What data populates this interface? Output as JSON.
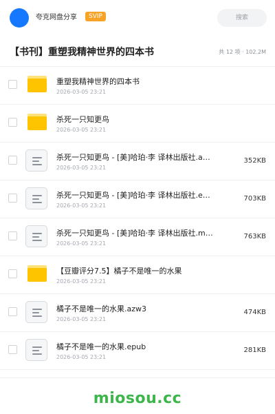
{
  "header": {
    "app_name": "夸克网盘分享",
    "badge": "SVIP",
    "search_placeholder": "搜索"
  },
  "folder": {
    "title": "【书刊】重塑我精神世界的四本书",
    "summary": "共 12 项 · 102.2M"
  },
  "files": [
    {
      "type": "folder",
      "icon": "folder-icon",
      "name": "重塑我精神世界的四本书",
      "date": "2026-03-05 23:21",
      "size": ""
    },
    {
      "type": "folder",
      "icon": "folder-icon",
      "name": "杀死一只知更鸟",
      "date": "2026-03-05 23:21",
      "size": ""
    },
    {
      "type": "file",
      "icon": "document-icon",
      "name": "杀死一只知更鸟 - [美]哈珀·李 译林出版社.a…",
      "date": "2026-03-05 23:21",
      "size": "352KB"
    },
    {
      "type": "file",
      "icon": "document-icon",
      "name": "杀死一只知更鸟 - [美]哈珀·李 译林出版社.e…",
      "date": "2026-03-05 23:21",
      "size": "703KB"
    },
    {
      "type": "file",
      "icon": "document-icon",
      "name": "杀死一只知更鸟 - [美]哈珀·李 译林出版社.m…",
      "date": "2026-03-05 23:21",
      "size": "763KB"
    },
    {
      "type": "folder",
      "icon": "folder-icon",
      "name": "【豆瓣评分7.5】橘子不是唯一的水果",
      "date": "2026-03-05 23:21",
      "size": ""
    },
    {
      "type": "file",
      "icon": "document-icon",
      "name": "橘子不是唯一的水果.azw3",
      "date": "2026-03-05 23:21",
      "size": "474KB"
    },
    {
      "type": "file",
      "icon": "document-icon",
      "name": "橘子不是唯一的水果.epub",
      "date": "2026-03-05 23:21",
      "size": "281KB"
    }
  ],
  "footer": {
    "watermark": "miosou.cc"
  },
  "colors": {
    "avatar": "#1677ff",
    "badge": "#f7a328",
    "folder": "#ffc400",
    "watermark": "#3cb54a"
  }
}
